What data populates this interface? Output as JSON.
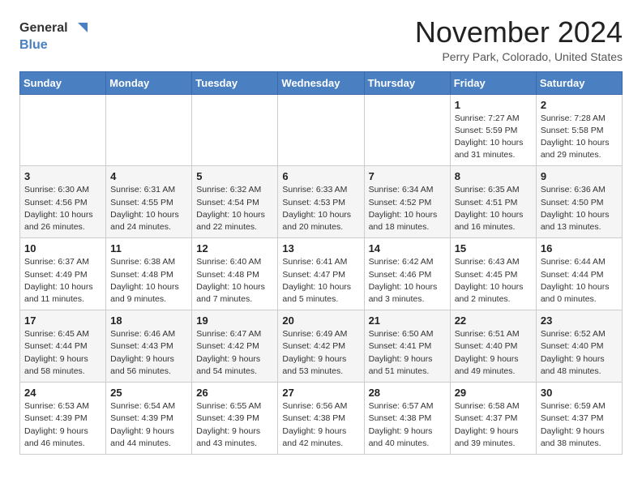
{
  "logo": {
    "line1": "General",
    "line2": "Blue"
  },
  "title": "November 2024",
  "location": "Perry Park, Colorado, United States",
  "days_of_week": [
    "Sunday",
    "Monday",
    "Tuesday",
    "Wednesday",
    "Thursday",
    "Friday",
    "Saturday"
  ],
  "weeks": [
    [
      {
        "day": "",
        "info": ""
      },
      {
        "day": "",
        "info": ""
      },
      {
        "day": "",
        "info": ""
      },
      {
        "day": "",
        "info": ""
      },
      {
        "day": "",
        "info": ""
      },
      {
        "day": "1",
        "info": "Sunrise: 7:27 AM\nSunset: 5:59 PM\nDaylight: 10 hours\nand 31 minutes."
      },
      {
        "day": "2",
        "info": "Sunrise: 7:28 AM\nSunset: 5:58 PM\nDaylight: 10 hours\nand 29 minutes."
      }
    ],
    [
      {
        "day": "3",
        "info": "Sunrise: 6:30 AM\nSunset: 4:56 PM\nDaylight: 10 hours\nand 26 minutes."
      },
      {
        "day": "4",
        "info": "Sunrise: 6:31 AM\nSunset: 4:55 PM\nDaylight: 10 hours\nand 24 minutes."
      },
      {
        "day": "5",
        "info": "Sunrise: 6:32 AM\nSunset: 4:54 PM\nDaylight: 10 hours\nand 22 minutes."
      },
      {
        "day": "6",
        "info": "Sunrise: 6:33 AM\nSunset: 4:53 PM\nDaylight: 10 hours\nand 20 minutes."
      },
      {
        "day": "7",
        "info": "Sunrise: 6:34 AM\nSunset: 4:52 PM\nDaylight: 10 hours\nand 18 minutes."
      },
      {
        "day": "8",
        "info": "Sunrise: 6:35 AM\nSunset: 4:51 PM\nDaylight: 10 hours\nand 16 minutes."
      },
      {
        "day": "9",
        "info": "Sunrise: 6:36 AM\nSunset: 4:50 PM\nDaylight: 10 hours\nand 13 minutes."
      }
    ],
    [
      {
        "day": "10",
        "info": "Sunrise: 6:37 AM\nSunset: 4:49 PM\nDaylight: 10 hours\nand 11 minutes."
      },
      {
        "day": "11",
        "info": "Sunrise: 6:38 AM\nSunset: 4:48 PM\nDaylight: 10 hours\nand 9 minutes."
      },
      {
        "day": "12",
        "info": "Sunrise: 6:40 AM\nSunset: 4:48 PM\nDaylight: 10 hours\nand 7 minutes."
      },
      {
        "day": "13",
        "info": "Sunrise: 6:41 AM\nSunset: 4:47 PM\nDaylight: 10 hours\nand 5 minutes."
      },
      {
        "day": "14",
        "info": "Sunrise: 6:42 AM\nSunset: 4:46 PM\nDaylight: 10 hours\nand 3 minutes."
      },
      {
        "day": "15",
        "info": "Sunrise: 6:43 AM\nSunset: 4:45 PM\nDaylight: 10 hours\nand 2 minutes."
      },
      {
        "day": "16",
        "info": "Sunrise: 6:44 AM\nSunset: 4:44 PM\nDaylight: 10 hours\nand 0 minutes."
      }
    ],
    [
      {
        "day": "17",
        "info": "Sunrise: 6:45 AM\nSunset: 4:44 PM\nDaylight: 9 hours\nand 58 minutes."
      },
      {
        "day": "18",
        "info": "Sunrise: 6:46 AM\nSunset: 4:43 PM\nDaylight: 9 hours\nand 56 minutes."
      },
      {
        "day": "19",
        "info": "Sunrise: 6:47 AM\nSunset: 4:42 PM\nDaylight: 9 hours\nand 54 minutes."
      },
      {
        "day": "20",
        "info": "Sunrise: 6:49 AM\nSunset: 4:42 PM\nDaylight: 9 hours\nand 53 minutes."
      },
      {
        "day": "21",
        "info": "Sunrise: 6:50 AM\nSunset: 4:41 PM\nDaylight: 9 hours\nand 51 minutes."
      },
      {
        "day": "22",
        "info": "Sunrise: 6:51 AM\nSunset: 4:40 PM\nDaylight: 9 hours\nand 49 minutes."
      },
      {
        "day": "23",
        "info": "Sunrise: 6:52 AM\nSunset: 4:40 PM\nDaylight: 9 hours\nand 48 minutes."
      }
    ],
    [
      {
        "day": "24",
        "info": "Sunrise: 6:53 AM\nSunset: 4:39 PM\nDaylight: 9 hours\nand 46 minutes."
      },
      {
        "day": "25",
        "info": "Sunrise: 6:54 AM\nSunset: 4:39 PM\nDaylight: 9 hours\nand 44 minutes."
      },
      {
        "day": "26",
        "info": "Sunrise: 6:55 AM\nSunset: 4:39 PM\nDaylight: 9 hours\nand 43 minutes."
      },
      {
        "day": "27",
        "info": "Sunrise: 6:56 AM\nSunset: 4:38 PM\nDaylight: 9 hours\nand 42 minutes."
      },
      {
        "day": "28",
        "info": "Sunrise: 6:57 AM\nSunset: 4:38 PM\nDaylight: 9 hours\nand 40 minutes."
      },
      {
        "day": "29",
        "info": "Sunrise: 6:58 AM\nSunset: 4:37 PM\nDaylight: 9 hours\nand 39 minutes."
      },
      {
        "day": "30",
        "info": "Sunrise: 6:59 AM\nSunset: 4:37 PM\nDaylight: 9 hours\nand 38 minutes."
      }
    ]
  ]
}
